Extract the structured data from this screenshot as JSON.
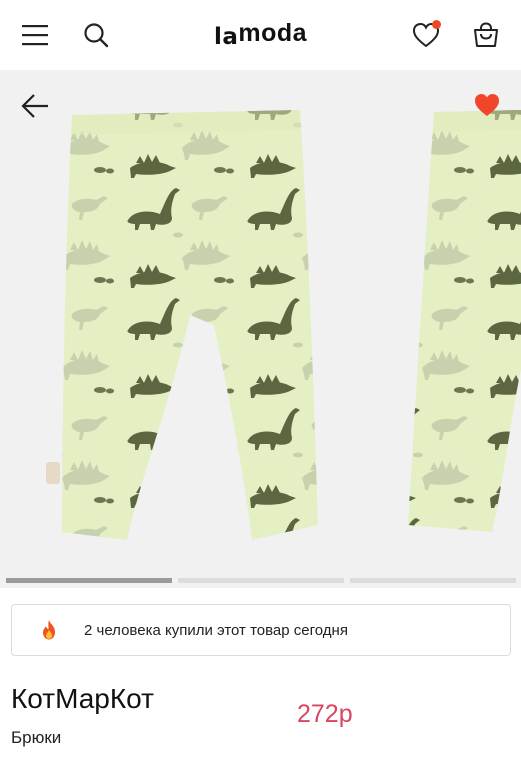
{
  "header": {
    "logo_prefix": "la",
    "logo_suffix": "moda",
    "has_favorites_notification": true
  },
  "gallery": {
    "slides_count": 3,
    "active_index": 0,
    "is_favorite": true
  },
  "social_proof": {
    "text": "2 человека купили этот товар сегодня",
    "icon": "fire-icon"
  },
  "product": {
    "brand": "КотМарКот",
    "type": "Брюки",
    "price": "272р"
  },
  "colors": {
    "price": "#d9465f",
    "favorite": "#f2462b",
    "pants": "#e4f0c4",
    "dino_dark": "#5c6640",
    "dino_light": "#c8d1ae"
  }
}
